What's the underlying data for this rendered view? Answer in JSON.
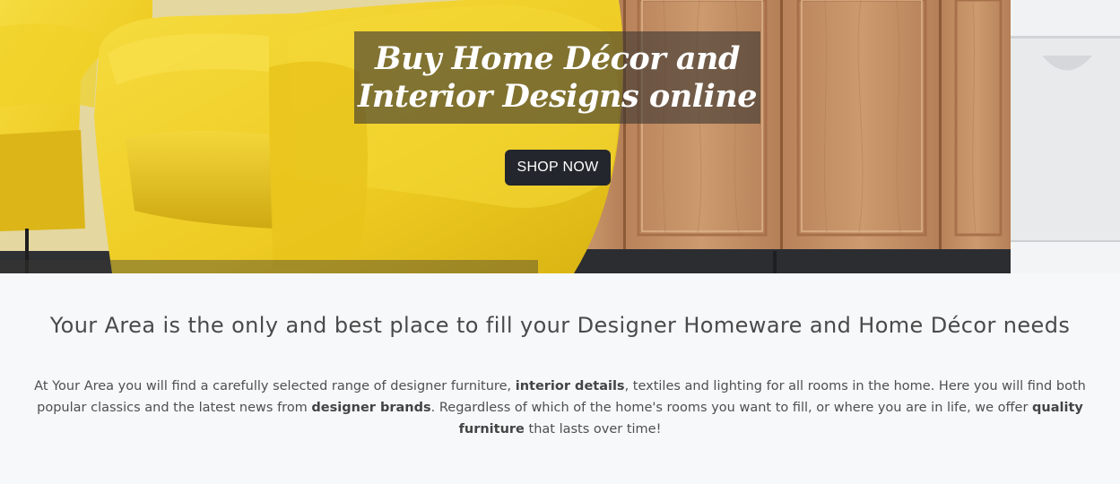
{
  "hero": {
    "title_line1": "Buy Home Décor and",
    "title_line2": "Interior Designs online",
    "shop_now_label": "SHOP NOW",
    "button_color": "#23262c",
    "chair_color": "#f2d22a",
    "cabinet_color": "#c48d5e"
  },
  "intro": {
    "heading": "Your Area is the only and best place to fill your Designer Homeware and Home Décor needs",
    "p1": "At Your Area you will find a carefully selected range of designer furniture, ",
    "b1": "interior details",
    "p2": ", textiles and lighting for all rooms in the home. Here you will find both popular classics and the latest news from ",
    "b2": "designer brands",
    "p3": ". Regardless of which of the home's rooms you want to fill, or where you are in life, we offer ",
    "b3": "quality furniture",
    "p4": " that lasts over time!"
  }
}
